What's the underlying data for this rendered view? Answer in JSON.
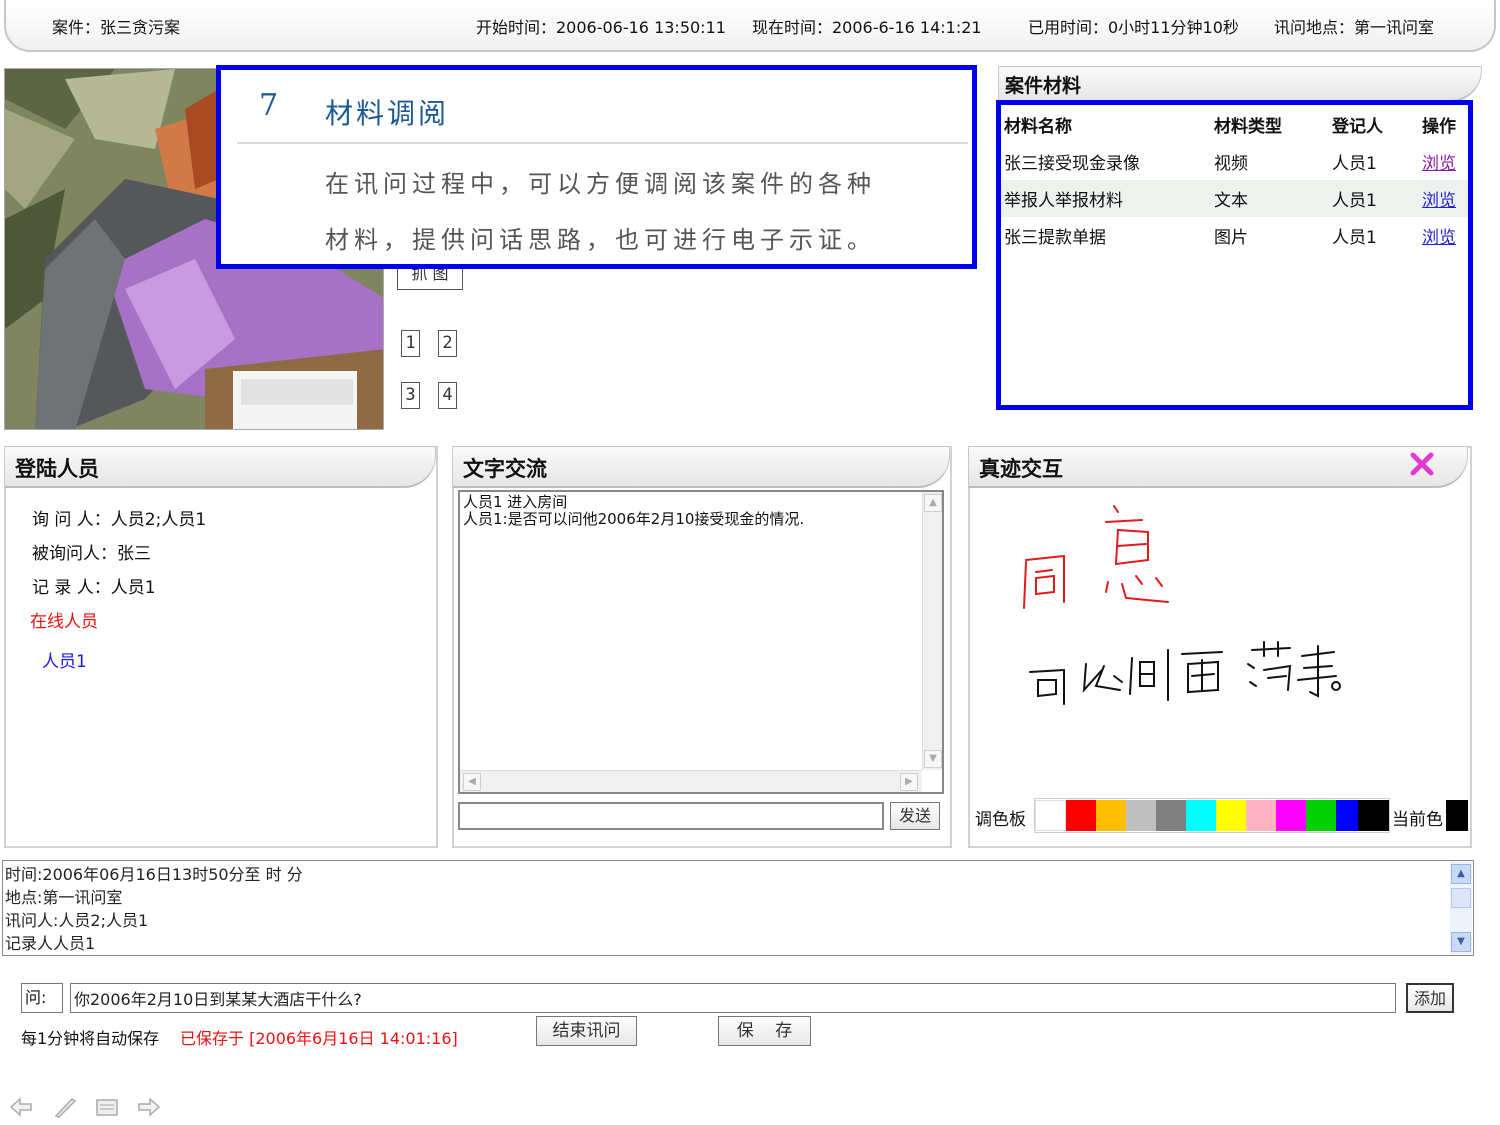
{
  "header": {
    "case_label": "案件：张三贪污案",
    "start_time": "开始时间：2006-06-16 13:50:11",
    "current_time": "现在时间：2006-6-16 14:1:21",
    "elapsed": "已用时间：0小时11分钟10秒",
    "location": "讯问地点：第一讯问室"
  },
  "video": {
    "capture_label": "抓 图",
    "channels": [
      "1",
      "2",
      "3",
      "4"
    ]
  },
  "callout": {
    "number": "7",
    "title": "材料调阅",
    "line1": "在讯问过程中，可以方便调阅该案件的各种",
    "line2": "材料，提供问话思路，也可进行电子示证。"
  },
  "materials": {
    "tab_title": "案件材料",
    "columns": [
      "材料名称",
      "材料类型",
      "登记人",
      "操作"
    ],
    "rows": [
      {
        "name": "张三接受现金录像",
        "type": "视频",
        "registrar": "人员1",
        "action": "浏览"
      },
      {
        "name": "举报人举报材料",
        "type": "文本",
        "registrar": "人员1",
        "action": "浏览"
      },
      {
        "name": "张三提款单据",
        "type": "图片",
        "registrar": "人员1",
        "action": "浏览"
      }
    ]
  },
  "login": {
    "tab_title": "登陆人员",
    "interrogator": "询 问 人：人员2;人员1",
    "interrogatee": "被询问人：张三",
    "recorder": "记 录 人：人员1",
    "online_label": "在线人员",
    "online_users": [
      "人员1"
    ]
  },
  "chat": {
    "tab_title": "文字交流",
    "messages": [
      "人员1 进入房间",
      "人员1:是否可以问他2006年2月10接受现金的情况."
    ],
    "input_value": "",
    "send_label": "发送"
  },
  "handwriting": {
    "tab_title": "真迹交互",
    "palette_label": "调色板",
    "current_color_label": "当前色",
    "palette_colors": [
      "#ffffff",
      "#ff0000",
      "#ffbf00",
      "#c0c0c0",
      "#808080",
      "#00ffff",
      "#ffff00",
      "#ffb3c0",
      "#ff00ff",
      "#00d000",
      "#0000ff",
      "#000000"
    ],
    "current_color": "#000000"
  },
  "record": {
    "lines": [
      "时间:2006年06月16日13时50分至  时  分",
      "地点:第一讯问室",
      "讯问人:人员2;人员1",
      "记录人人员1"
    ]
  },
  "question": {
    "label": "问:",
    "value": "你2006年2月10日到某某大酒店干什么?",
    "add_label": "添加"
  },
  "footer": {
    "autosave": "每1分钟将自动保存",
    "saved_at": "已保存于 [2006年6月16日 14:01:16]",
    "end_label": "结束讯问",
    "save_label": "保    存"
  },
  "nav_icons": [
    "back-arrow-icon",
    "pen-icon",
    "menu-icon",
    "forward-arrow-icon"
  ]
}
